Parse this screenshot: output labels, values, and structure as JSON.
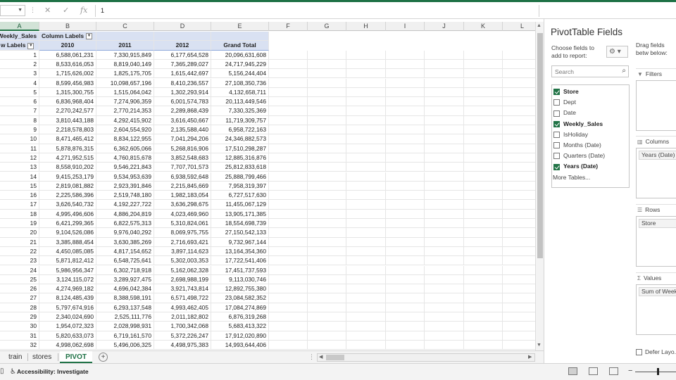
{
  "formula_bar": {
    "value": "1"
  },
  "columns": [
    "A",
    "B",
    "C",
    "D",
    "E",
    "F",
    "G",
    "H",
    "I",
    "J",
    "K",
    "L"
  ],
  "pivot": {
    "value_field_label": "Weekly_Sales",
    "column_labels": "Column Labels",
    "row_labels": "w Labels",
    "years": [
      "2010",
      "2011",
      "2012"
    ],
    "grand_total": "Grand Total",
    "rows": [
      [
        "1",
        "6,588,061,231",
        "7,330,915,849",
        "6,177,654,528",
        "20,096,631,608"
      ],
      [
        "2",
        "8,533,616,053",
        "8,819,040,149",
        "7,365,289,027",
        "24,717,945,229"
      ],
      [
        "3",
        "1,715,626,002",
        "1,825,175,705",
        "1,615,442,697",
        "5,156,244,404"
      ],
      [
        "4",
        "8,599,456,983",
        "10,098,657,196",
        "8,410,236,557",
        "27,108,350,736"
      ],
      [
        "5",
        "1,315,300,755",
        "1,515,064,042",
        "1,302,293,914",
        "4,132,658,711"
      ],
      [
        "6",
        "6,836,968,404",
        "7,274,906,359",
        "6,001,574,783",
        "20,113,449,546"
      ],
      [
        "7",
        "2,270,242,577",
        "2,770,214,353",
        "2,289,868,439",
        "7,330,325,369"
      ],
      [
        "8",
        "3,810,443,188",
        "4,292,415,902",
        "3,616,450,667",
        "11,719,309,757"
      ],
      [
        "9",
        "2,218,578,803",
        "2,604,554,920",
        "2,135,588,440",
        "6,958,722,163"
      ],
      [
        "10",
        "8,471,465,412",
        "8,834,122,955",
        "7,041,294,206",
        "24,346,882,573"
      ],
      [
        "11",
        "5,878,876,315",
        "6,362,605,066",
        "5,268,816,906",
        "17,510,298,287"
      ],
      [
        "12",
        "4,271,952,515",
        "4,760,815,678",
        "3,852,548,683",
        "12,885,316,876"
      ],
      [
        "13",
        "8,558,910,202",
        "9,546,221,843",
        "7,707,701,573",
        "25,812,833,618"
      ],
      [
        "14",
        "9,415,253,179",
        "9,534,953,639",
        "6,938,592,648",
        "25,888,799,466"
      ],
      [
        "15",
        "2,819,081,882",
        "2,923,391,846",
        "2,215,845,669",
        "7,958,319,397"
      ],
      [
        "16",
        "2,225,586,396",
        "2,519,748,180",
        "1,982,183,054",
        "6,727,517,630"
      ],
      [
        "17",
        "3,626,540,732",
        "4,192,227,722",
        "3,636,298,675",
        "11,455,067,129"
      ],
      [
        "18",
        "4,995,496,606",
        "4,886,204,819",
        "4,023,469,960",
        "13,905,171,385"
      ],
      [
        "19",
        "6,421,299,365",
        "6,822,575,313",
        "5,310,824,061",
        "18,554,698,739"
      ],
      [
        "20",
        "9,104,526,086",
        "9,976,040,292",
        "8,069,975,755",
        "27,150,542,133"
      ],
      [
        "21",
        "3,385,888,454",
        "3,630,385,269",
        "2,716,693,421",
        "9,732,967,144"
      ],
      [
        "22",
        "4,450,085,085",
        "4,817,154,652",
        "3,897,114,623",
        "13,164,354,360"
      ],
      [
        "23",
        "5,871,812,412",
        "6,548,725,641",
        "5,302,003,353",
        "17,722,541,406"
      ],
      [
        "24",
        "5,986,956,347",
        "6,302,718,918",
        "5,162,062,328",
        "17,451,737,593"
      ],
      [
        "25",
        "3,124,115,072",
        "3,289,927,475",
        "2,698,988,199",
        "9,113,030,746"
      ],
      [
        "26",
        "4,274,969,182",
        "4,696,042,384",
        "3,921,743,814",
        "12,892,755,380"
      ],
      [
        "27",
        "8,124,485,439",
        "8,388,598,191",
        "6,571,498,722",
        "23,084,582,352"
      ],
      [
        "28",
        "5,797,674,916",
        "6,293,137,548",
        "4,993,462,405",
        "17,084,274,869"
      ],
      [
        "29",
        "2,340,024,690",
        "2,525,111,776",
        "2,011,182,802",
        "6,876,319,268"
      ],
      [
        "30",
        "1,954,072,323",
        "2,028,998,931",
        "1,700,342,068",
        "5,683,413,322"
      ],
      [
        "31",
        "5,820,633,073",
        "6,719,161,570",
        "5,372,226,247",
        "17,912,020,890"
      ],
      [
        "32",
        "4,998,062,698",
        "5,496,006,325",
        "4,498,975,383",
        "14,993,644,406"
      ]
    ]
  },
  "sheets": [
    "train",
    "stores",
    "PIVOT"
  ],
  "active_sheet": "PIVOT",
  "status": {
    "accessibility": "Accessibility: Investigate"
  },
  "pivot_pane": {
    "title": "PivotTable Fields",
    "choose_label": "Choose fields to add to report:",
    "drag_label": "Drag fields betw below:",
    "search_placeholder": "Search",
    "fields": [
      {
        "name": "Store",
        "checked": true
      },
      {
        "name": "Dept",
        "checked": false
      },
      {
        "name": "Date",
        "checked": false
      },
      {
        "name": "Weekly_Sales",
        "checked": true
      },
      {
        "name": "IsHoliday",
        "checked": false
      },
      {
        "name": "Months (Date)",
        "checked": false
      },
      {
        "name": "Quarters (Date)",
        "checked": false
      },
      {
        "name": "Years (Date)",
        "checked": true
      }
    ],
    "more_tables": "More Tables...",
    "areas": {
      "filters": {
        "title": "Filters",
        "items": []
      },
      "columns": {
        "title": "Columns",
        "items": [
          "Years (Date)"
        ]
      },
      "rows": {
        "title": "Rows",
        "items": [
          "Store"
        ]
      },
      "values": {
        "title": "Values",
        "items": [
          "Sum of Weekly"
        ]
      }
    },
    "defer_label": "Defer Layo..."
  },
  "colors": {
    "accent": "#217346",
    "pivot_header": "#d9e1f2"
  }
}
